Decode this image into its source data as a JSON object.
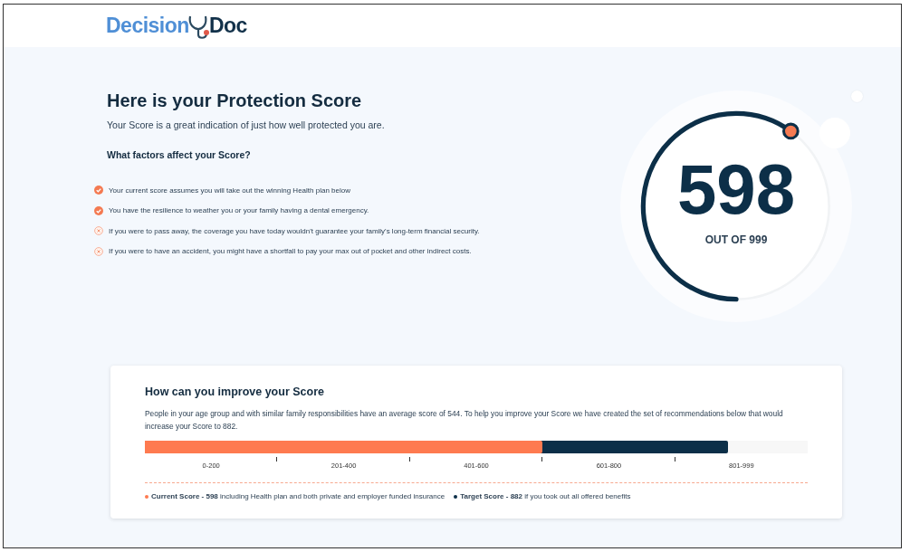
{
  "logo": {
    "first": "Decision",
    "second": "Doc"
  },
  "score_section": {
    "title": "Here is your Protection Score",
    "subtitle": "Your Score is a great indication of just how well protected you are.",
    "factors_heading": "What factors affect your Score?",
    "factors": [
      {
        "text": "Your current score assumes you will take out the winning Health plan below",
        "met": true
      },
      {
        "text": "You have the resilience to weather you or your family having a dental emergency.",
        "met": true
      },
      {
        "text": "If you were to pass away, the coverage you have today wouldn't guarantee your family's long-term financial security.",
        "met": false
      },
      {
        "text": "If you were to have an accident, you might have a shortfall to pay your max out of pocket and other indirect costs.",
        "met": false
      }
    ]
  },
  "gauge": {
    "score": "598",
    "caption": "OUT OF 999"
  },
  "improve_card": {
    "title": "How can you improve your Score",
    "text": "People in your age group and with similar family responsibilities have an average score of 544. To help you improve your Score we have created the set of recommendations below that would increase your Score to 882.",
    "bar": {
      "current": {
        "level": 0.6,
        "color": "#fe7a50"
      },
      "target": {
        "level": 0.88,
        "color": "#0c2f48"
      }
    },
    "ranges": [
      "0-200",
      "201-400",
      "401-600",
      "601-800",
      "801-999"
    ],
    "legend": [
      {
        "text": "**Current Score - 598** including Health plan and both private and employer funded insurance",
        "color": "#fe7a50"
      },
      {
        "text": "**Target Score - 882** if you took out all offered benefits",
        "color": "#0c2f48"
      }
    ]
  }
}
